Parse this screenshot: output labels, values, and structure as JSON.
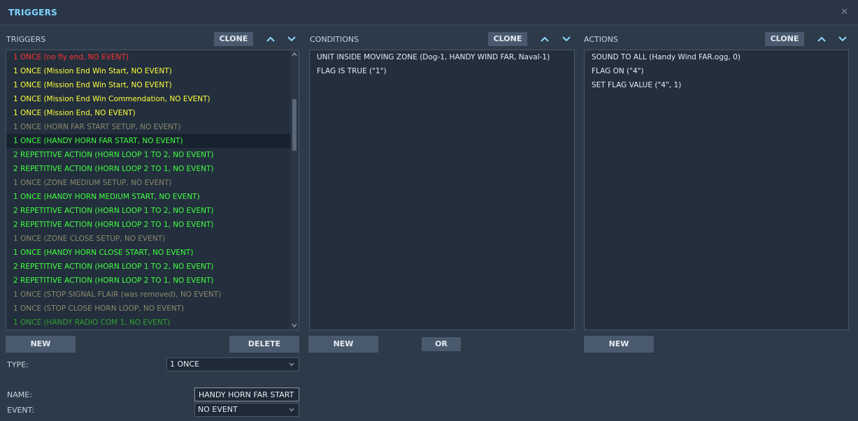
{
  "window": {
    "title": "TRIGGERS"
  },
  "triggers": {
    "label": "TRIGGERS",
    "clone_label": "CLONE",
    "new_label": "NEW",
    "delete_label": "DELETE",
    "items": [
      {
        "text": "1 ONCE (no fly end, NO EVENT)",
        "color": "#ff3030"
      },
      {
        "text": "1 ONCE (Mission End Win Start, NO EVENT)",
        "color": "#ffff3a"
      },
      {
        "text": "1 ONCE (Mission End Win Start, NO EVENT)",
        "color": "#ffff3a"
      },
      {
        "text": "1 ONCE (Mission End Win Commendation, NO EVENT)",
        "color": "#ffff3a"
      },
      {
        "text": "1 ONCE (Mission End, NO EVENT)",
        "color": "#ffff3a"
      },
      {
        "text": "1 ONCE (HORN FAR START SETUP, NO EVENT)",
        "color": "#8a8a6a"
      },
      {
        "text": "1 ONCE (HANDY HORN FAR START, NO EVENT)",
        "color": "#40ff40",
        "selected": true
      },
      {
        "text": "2 REPETITIVE ACTION (HORN LOOP 1 TO 2, NO EVENT)",
        "color": "#40ff40"
      },
      {
        "text": "2 REPETITIVE ACTION (HORN LOOP 2 TO 1, NO EVENT)",
        "color": "#40ff40"
      },
      {
        "text": "1 ONCE (ZONE MEDIUM SETUP, NO EVENT)",
        "color": "#8a8a6a"
      },
      {
        "text": "1 ONCE (HANDY HORN MEDIUM START, NO EVENT)",
        "color": "#40ff40"
      },
      {
        "text": "2 REPETITIVE ACTION (HORN LOOP 1 TO 2, NO EVENT)",
        "color": "#40ff40"
      },
      {
        "text": "2 REPETITIVE ACTION (HORN LOOP 2 TO 1, NO EVENT)",
        "color": "#40ff40"
      },
      {
        "text": "1 ONCE (ZONE CLOSE SETUP, NO EVENT)",
        "color": "#8a8a6a"
      },
      {
        "text": "1 ONCE (HANDY HORN CLOSE START, NO EVENT)",
        "color": "#40ff40"
      },
      {
        "text": "2 REPETITIVE ACTION (HORN LOOP 1 TO 2, NO EVENT)",
        "color": "#40ff40"
      },
      {
        "text": "2 REPETITIVE ACTION (HORN LOOP 2 TO 1, NO EVENT)",
        "color": "#40ff40"
      },
      {
        "text": "1 ONCE (STOP SIGNAL FLAIR (was removed), NO EVENT)",
        "color": "#8a8a6a"
      },
      {
        "text": "1 ONCE (STOP CLOSE HORN LOOP, NO EVENT)",
        "color": "#8a8a6a"
      },
      {
        "text": "1 ONCE (HANDY RADIO COM 1, NO EVENT)",
        "color": "#30a030"
      }
    ]
  },
  "conditions": {
    "label": "CONDITIONS",
    "clone_label": "CLONE",
    "new_label": "NEW",
    "or_label": "OR",
    "items": [
      "UNIT INSIDE MOVING ZONE (Dog-1, HANDY WIND FAR, Naval-1)",
      "FLAG IS TRUE (\"1\")"
    ]
  },
  "actions": {
    "label": "ACTIONS",
    "clone_label": "CLONE",
    "new_label": "NEW",
    "items": [
      "SOUND TO ALL (Handy Wind FAR.ogg, 0)",
      "FLAG ON (\"4\")",
      "SET FLAG VALUE (\"4\", 1)"
    ]
  },
  "form": {
    "type_label": "TYPE:",
    "type_value": "1 ONCE",
    "name_label": "NAME:",
    "name_value": "HANDY HORN FAR START",
    "event_label": "EVENT:",
    "event_value": "NO EVENT"
  },
  "icons": {
    "close": "close-icon",
    "move_up": "chevron-up-icon",
    "move_down": "chevron-down-icon"
  }
}
